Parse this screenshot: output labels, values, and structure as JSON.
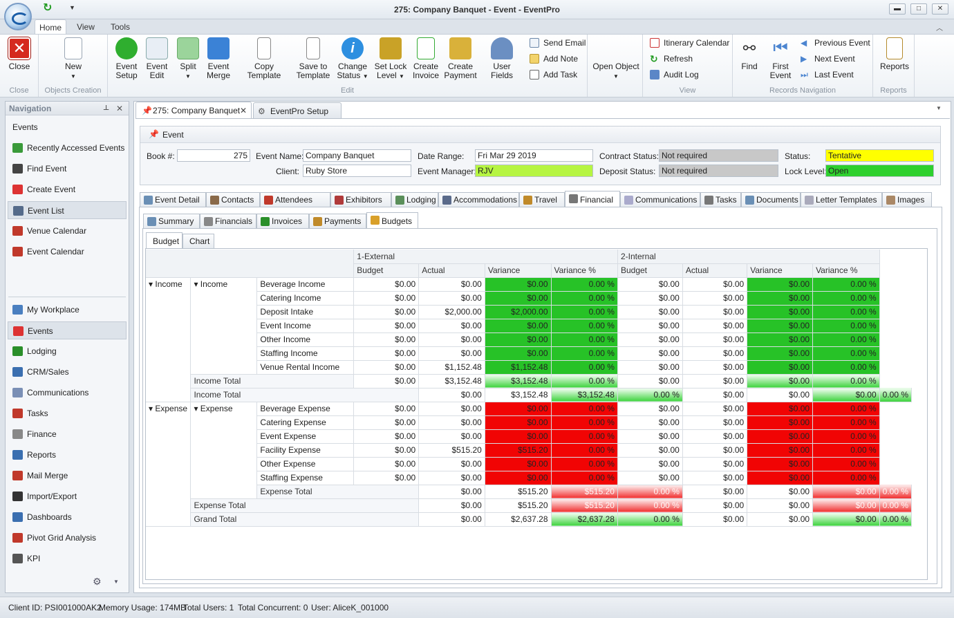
{
  "window": {
    "title": "275: Company Banquet - Event - EventPro",
    "min": "▬",
    "max": "□",
    "close": "✕"
  },
  "menu_tabs": [
    "Home",
    "View",
    "Tools"
  ],
  "ribbon": {
    "close_group": {
      "label": "Close",
      "close": "Close"
    },
    "objects_group": {
      "label": "Objects Creation",
      "new": "New"
    },
    "edit_group": {
      "label": "Edit",
      "event_setup": [
        "Event",
        "Setup"
      ],
      "event_edit": [
        "Event",
        "Edit"
      ],
      "split": "Split",
      "event_merge": [
        "Event",
        "Merge"
      ],
      "copy_template": "Copy Template",
      "save_template": [
        "Save to",
        "Template"
      ],
      "change_status": [
        "Change",
        "Status"
      ],
      "set_lock": [
        "Set Lock",
        "Level"
      ],
      "create_invoice": [
        "Create",
        "Invoice"
      ],
      "create_payment": [
        "Create",
        "Payment"
      ],
      "user_fields": "User Fields",
      "send_email": "Send Email",
      "add_note": "Add Note",
      "add_task": "Add Task"
    },
    "open_object": "Open Object",
    "view_group": {
      "label": "View",
      "itinerary": "Itinerary Calendar",
      "refresh": "Refresh",
      "audit": "Audit Log"
    },
    "records_group": {
      "label": "Records Navigation",
      "find": "Find",
      "first_event": [
        "First",
        "Event"
      ],
      "previous": "Previous Event",
      "next": "Next Event",
      "last": "Last Event"
    },
    "reports_group": {
      "label": "Reports",
      "reports": "Reports"
    }
  },
  "nav": {
    "title": "Navigation",
    "section": "Events",
    "top_items": [
      "Recently Accessed Events",
      "Find Event",
      "Create Event",
      "Event List",
      "Venue Calendar",
      "Event Calendar"
    ],
    "bottom_items": [
      "My Workplace",
      "Events",
      "Lodging",
      "CRM/Sales",
      "Communications",
      "Tasks",
      "Finance",
      "Reports",
      "Mail Merge",
      "Import/Export",
      "Dashboards",
      "Pivot Grid Analysis",
      "KPI"
    ]
  },
  "doc_tabs": [
    "275: Company Banquet",
    "EventPro Setup"
  ],
  "event": {
    "header": "Event",
    "book_label": "Book #:",
    "book": "275",
    "name_label": "Event Name:",
    "name": "Company Banquet",
    "client_label": "Client:",
    "client": "Ruby Store",
    "date_label": "Date Range:",
    "date": "Fri Mar 29 2019",
    "manager_label": "Event Manager:",
    "manager": "RJV",
    "contract_label": "Contract Status:",
    "contract": "Not required",
    "deposit_label": "Deposit Status:",
    "deposit": "Not required",
    "status_label": "Status:",
    "status": "Tentative",
    "lock_label": "Lock Level:",
    "lock": "Open",
    "colors": {
      "status": "#ffff00",
      "lock": "#2ed02e",
      "manager": "#b6f542",
      "grey": "#c8c8c8"
    }
  },
  "event_tabs": [
    "Event Detail",
    "Contacts",
    "Attendees",
    "Exhibitors",
    "Lodging",
    "Accommodations",
    "Travel",
    "Financial",
    "Communications",
    "Tasks",
    "Documents",
    "Letter Templates",
    "Images"
  ],
  "financial_tabs": [
    "Summary",
    "Financials",
    "Invoices",
    "Payments",
    "Budgets"
  ],
  "budget_tabs": [
    "Budget",
    "Chart"
  ],
  "grid": {
    "groups": [
      "1-External",
      "2-Internal"
    ],
    "columns": [
      "Budget",
      "Actual",
      "Variance",
      "Variance %",
      "Budget",
      "Actual",
      "Variance",
      "Variance %"
    ],
    "rows": [
      {
        "l1": "Income",
        "l2": "Income",
        "l3": "Beverage Income",
        "v": [
          "$0.00",
          "$0.00",
          "$0.00",
          "0.00 %",
          "$0.00",
          "$0.00",
          "$0.00",
          "0.00 %"
        ],
        "c": "g"
      },
      {
        "l3": "Catering Income",
        "v": [
          "$0.00",
          "$0.00",
          "$0.00",
          "0.00 %",
          "$0.00",
          "$0.00",
          "$0.00",
          "0.00 %"
        ],
        "c": "g"
      },
      {
        "l3": "Deposit Intake",
        "v": [
          "$0.00",
          "$2,000.00",
          "$2,000.00",
          "0.00 %",
          "$0.00",
          "$0.00",
          "$0.00",
          "0.00 %"
        ],
        "c": "g"
      },
      {
        "l3": "Event Income",
        "v": [
          "$0.00",
          "$0.00",
          "$0.00",
          "0.00 %",
          "$0.00",
          "$0.00",
          "$0.00",
          "0.00 %"
        ],
        "c": "g"
      },
      {
        "l3": "Other Income",
        "v": [
          "$0.00",
          "$0.00",
          "$0.00",
          "0.00 %",
          "$0.00",
          "$0.00",
          "$0.00",
          "0.00 %"
        ],
        "c": "g"
      },
      {
        "l3": "Staffing Income",
        "v": [
          "$0.00",
          "$0.00",
          "$0.00",
          "0.00 %",
          "$0.00",
          "$0.00",
          "$0.00",
          "0.00 %"
        ],
        "c": "g"
      },
      {
        "l3": "Venue Rental Income",
        "v": [
          "$0.00",
          "$1,152.48",
          "$1,152.48",
          "0.00 %",
          "$0.00",
          "$0.00",
          "$0.00",
          "0.00 %"
        ],
        "c": "g"
      },
      {
        "sub": "Income Total",
        "v": [
          "$0.00",
          "$3,152.48",
          "$3,152.48",
          "0.00 %",
          "$0.00",
          "$0.00",
          "$0.00",
          "0.00 %"
        ],
        "c": "gt"
      },
      {
        "total": "Income Total",
        "v": [
          "$0.00",
          "$3,152.48",
          "$3,152.48",
          "0.00 %",
          "$0.00",
          "$0.00",
          "$0.00",
          "0.00 %"
        ],
        "c": "gt"
      },
      {
        "l1": "Expense",
        "l2": "Expense",
        "l3": "Beverage Expense",
        "v": [
          "$0.00",
          "$0.00",
          "$0.00",
          "0.00 %",
          "$0.00",
          "$0.00",
          "$0.00",
          "0.00 %"
        ],
        "c": "r"
      },
      {
        "l3": "Catering Expense",
        "v": [
          "$0.00",
          "$0.00",
          "$0.00",
          "0.00 %",
          "$0.00",
          "$0.00",
          "$0.00",
          "0.00 %"
        ],
        "c": "r"
      },
      {
        "l3": "Event Expense",
        "v": [
          "$0.00",
          "$0.00",
          "$0.00",
          "0.00 %",
          "$0.00",
          "$0.00",
          "$0.00",
          "0.00 %"
        ],
        "c": "r"
      },
      {
        "l3": "Facility Expense",
        "v": [
          "$0.00",
          "$515.20",
          "$515.20",
          "0.00 %",
          "$0.00",
          "$0.00",
          "$0.00",
          "0.00 %"
        ],
        "c": "r"
      },
      {
        "l3": "Other Expense",
        "v": [
          "$0.00",
          "$0.00",
          "$0.00",
          "0.00 %",
          "$0.00",
          "$0.00",
          "$0.00",
          "0.00 %"
        ],
        "c": "r"
      },
      {
        "l3": "Staffing Expense",
        "v": [
          "$0.00",
          "$0.00",
          "$0.00",
          "0.00 %",
          "$0.00",
          "$0.00",
          "$0.00",
          "0.00 %"
        ],
        "c": "r"
      },
      {
        "sub": "Expense Total",
        "v": [
          "$0.00",
          "$515.20",
          "$515.20",
          "0.00 %",
          "$0.00",
          "$0.00",
          "$0.00",
          "0.00 %"
        ],
        "c": "rt"
      },
      {
        "total": "Expense Total",
        "v": [
          "$0.00",
          "$515.20",
          "$515.20",
          "0.00 %",
          "$0.00",
          "$0.00",
          "$0.00",
          "0.00 %"
        ],
        "c": "rt"
      },
      {
        "total": "Grand Total",
        "v": [
          "$0.00",
          "$2,637.28",
          "$2,637.28",
          "0.00 %",
          "$0.00",
          "$0.00",
          "$0.00",
          "0.00 %"
        ],
        "c": "gt"
      }
    ]
  },
  "status": {
    "client_id": "Client ID: PSI001000AK2",
    "memory": "Memory Usage: 174MB",
    "users": "Total Users: 1",
    "concurrent": "Total Concurrent: 0",
    "user": "User: AliceK_001000"
  }
}
